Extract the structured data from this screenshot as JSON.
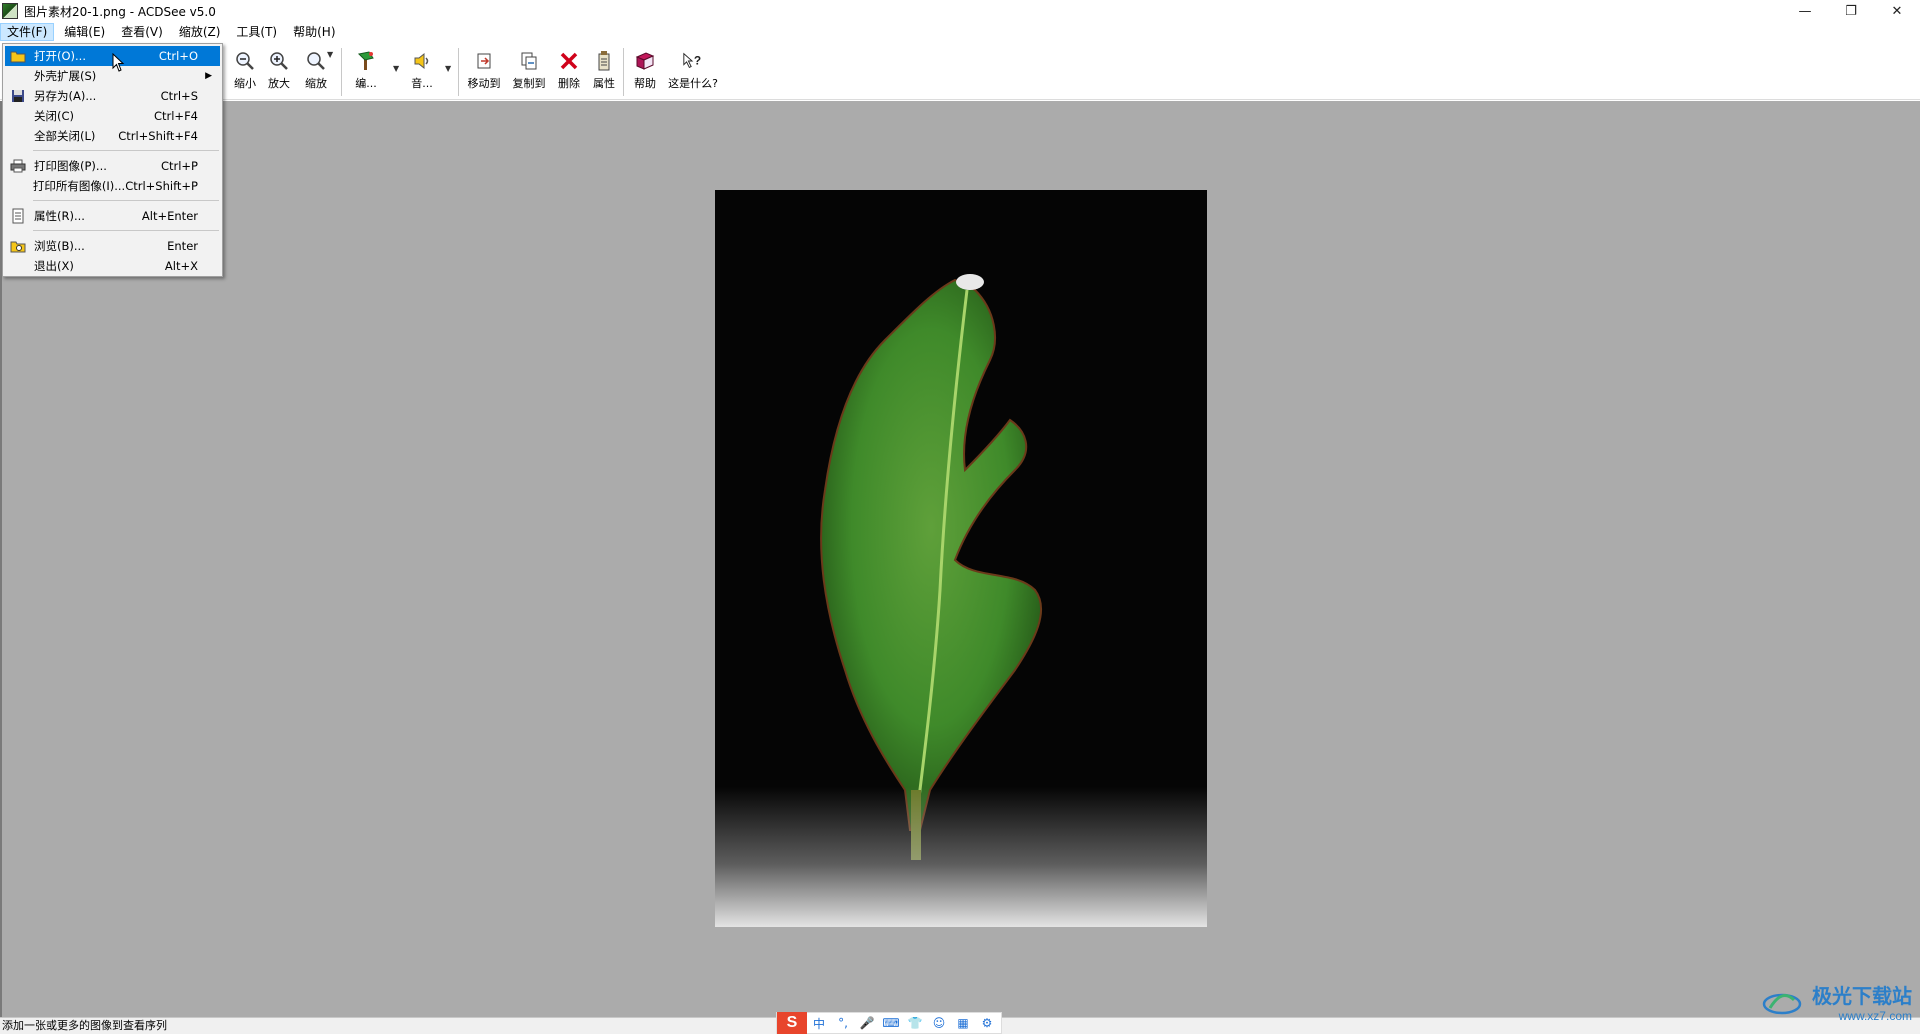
{
  "window": {
    "title": "图片素材20-1.png - ACDSee v5.0",
    "controls": {
      "minimize": "—",
      "restore": "❐",
      "close": "✕"
    }
  },
  "menubar": [
    {
      "label": "文件(F)",
      "active": true
    },
    {
      "label": "编辑(E)"
    },
    {
      "label": "查看(V)"
    },
    {
      "label": "缩放(Z)"
    },
    {
      "label": "工具(T)"
    },
    {
      "label": "帮助(H)"
    }
  ],
  "toolbar": [
    {
      "label": "缩小",
      "icon": "zoom-out-icon"
    },
    {
      "label": "放大",
      "icon": "zoom-in-icon"
    },
    {
      "label": "缩放",
      "icon": "zoom-icon"
    },
    {
      "label": "编...",
      "icon": "edit-icon"
    },
    {
      "label": "音...",
      "icon": "audio-icon"
    },
    {
      "label": "移动到",
      "icon": "move-to-icon"
    },
    {
      "label": "复制到",
      "icon": "copy-to-icon"
    },
    {
      "label": "删除",
      "icon": "delete-icon"
    },
    {
      "label": "属性",
      "icon": "properties-icon"
    },
    {
      "label": "帮助",
      "icon": "help-icon"
    },
    {
      "label": "这是什么?",
      "icon": "whats-this-icon"
    }
  ],
  "file_menu": [
    {
      "label": "打开(O)...",
      "shortcut": "Ctrl+O",
      "icon": "open-folder-icon",
      "highlighted": true
    },
    {
      "label": "外壳扩展(S)",
      "shortcut": "",
      "submenu": true
    },
    {
      "label": "另存为(A)...",
      "shortcut": "Ctrl+S",
      "icon": "save-icon"
    },
    {
      "label": "关闭(C)",
      "shortcut": "Ctrl+F4"
    },
    {
      "label": "全部关闭(L)",
      "shortcut": "Ctrl+Shift+F4"
    },
    {
      "label": "打印图像(P)...",
      "shortcut": "Ctrl+P",
      "icon": "printer-icon"
    },
    {
      "label": "打印所有图像(I)...",
      "shortcut": "Ctrl+Shift+P"
    },
    {
      "label": "属性(R)...",
      "shortcut": "Alt+Enter",
      "icon": "properties-icon"
    },
    {
      "label": "浏览(B)...",
      "shortcut": "Enter",
      "icon": "browse-icon"
    },
    {
      "label": "退出(X)",
      "shortcut": "Alt+X"
    }
  ],
  "statusbar": {
    "text": "添加一张或更多的图像到查看序列"
  },
  "ime": {
    "logo": "S",
    "items": [
      "中",
      "°,",
      "🎤",
      "⌨",
      "👕",
      "☺",
      "▦",
      "⚙"
    ]
  },
  "watermark": {
    "title": "极光下载站",
    "url": "www.xz7.com"
  },
  "colors": {
    "viewer_bg": "#ababab",
    "menu_highlight": "#0078d7",
    "leaf_green": "#3f8a2a"
  }
}
